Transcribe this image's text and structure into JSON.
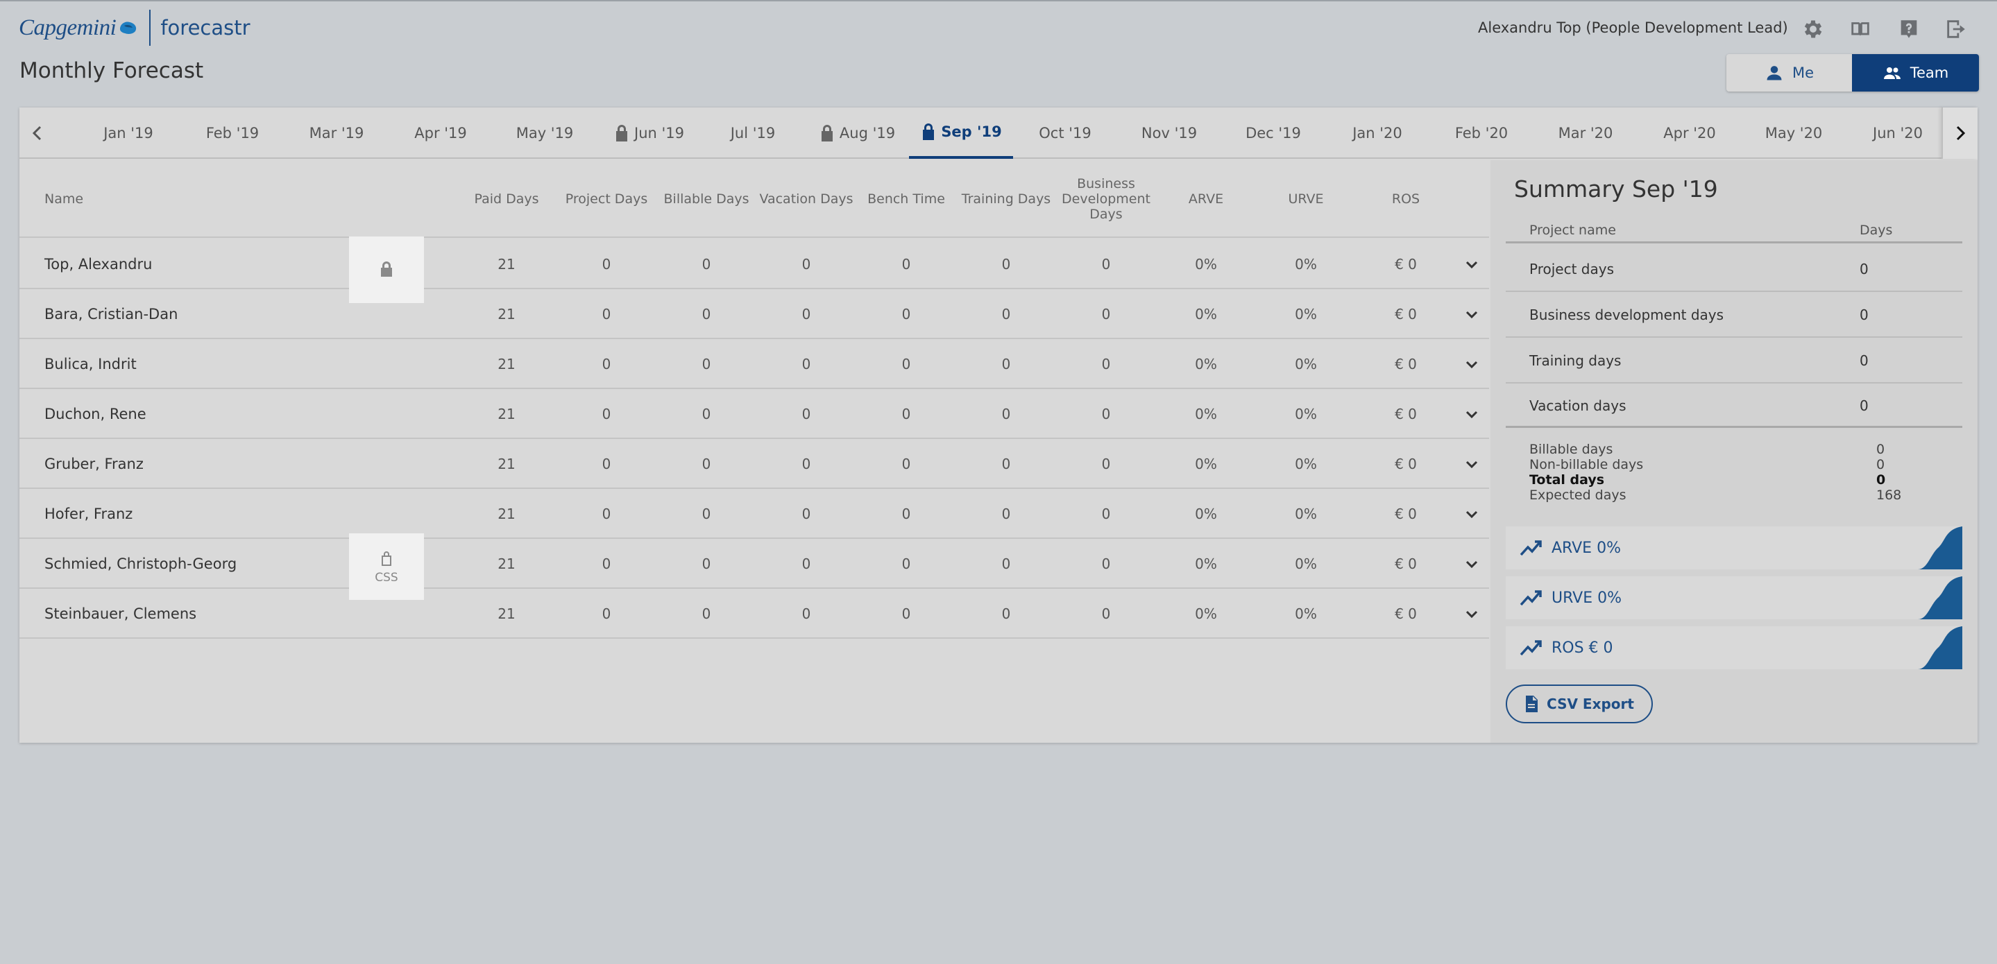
{
  "header": {
    "logo_brand": "Capgemini",
    "logo_product": "forecastr",
    "user": "Alexandru Top (People Development Lead)",
    "icons": [
      "gear-icon",
      "book-icon",
      "help-icon",
      "logout-icon"
    ]
  },
  "page_title": "Monthly Forecast",
  "view_toggle": {
    "me": "Me",
    "team": "Team",
    "selected": "Team"
  },
  "months": [
    {
      "label": "Jan '19",
      "locked": false
    },
    {
      "label": "Feb '19",
      "locked": false
    },
    {
      "label": "Mar '19",
      "locked": false
    },
    {
      "label": "Apr '19",
      "locked": false
    },
    {
      "label": "May '19",
      "locked": false
    },
    {
      "label": "Jun '19",
      "locked": true
    },
    {
      "label": "Jul '19",
      "locked": false
    },
    {
      "label": "Aug '19",
      "locked": true
    },
    {
      "label": "Sep '19",
      "locked": true,
      "active": true
    },
    {
      "label": "Oct '19",
      "locked": false
    },
    {
      "label": "Nov '19",
      "locked": false
    },
    {
      "label": "Dec '19",
      "locked": false
    },
    {
      "label": "Jan '20",
      "locked": false
    },
    {
      "label": "Feb '20",
      "locked": false
    },
    {
      "label": "Mar '20",
      "locked": false
    },
    {
      "label": "Apr '20",
      "locked": false
    },
    {
      "label": "May '20",
      "locked": false
    },
    {
      "label": "Jun '20",
      "locked": false
    }
  ],
  "table": {
    "columns": {
      "name": "Name",
      "paid": "Paid Days",
      "project": "Project Days",
      "billable": "Billable Days",
      "vacation": "Vacation Days",
      "bench": "Bench Time",
      "training": "Training Days",
      "bizdev": "Business Development Days",
      "arve": "ARVE",
      "urve": "URVE",
      "ros": "ROS"
    },
    "rows": [
      {
        "name": "Top, Alexandru",
        "paid": "21",
        "project": "0",
        "billable": "0",
        "vacation": "0",
        "bench": "0",
        "training": "0",
        "bizdev": "0",
        "arve": "0%",
        "urve": "0%",
        "ros": "€ 0"
      },
      {
        "name": "Bara, Cristian-Dan",
        "paid": "21",
        "project": "0",
        "billable": "0",
        "vacation": "0",
        "bench": "0",
        "training": "0",
        "bizdev": "0",
        "arve": "0%",
        "urve": "0%",
        "ros": "€ 0"
      },
      {
        "name": "Bulica, Indrit",
        "paid": "21",
        "project": "0",
        "billable": "0",
        "vacation": "0",
        "bench": "0",
        "training": "0",
        "bizdev": "0",
        "arve": "0%",
        "urve": "0%",
        "ros": "€ 0"
      },
      {
        "name": "Duchon, Rene",
        "paid": "21",
        "project": "0",
        "billable": "0",
        "vacation": "0",
        "bench": "0",
        "training": "0",
        "bizdev": "0",
        "arve": "0%",
        "urve": "0%",
        "ros": "€ 0"
      },
      {
        "name": "Gruber, Franz",
        "paid": "21",
        "project": "0",
        "billable": "0",
        "vacation": "0",
        "bench": "0",
        "training": "0",
        "bizdev": "0",
        "arve": "0%",
        "urve": "0%",
        "ros": "€ 0"
      },
      {
        "name": "Hofer, Franz",
        "paid": "21",
        "project": "0",
        "billable": "0",
        "vacation": "0",
        "bench": "0",
        "training": "0",
        "bizdev": "0",
        "arve": "0%",
        "urve": "0%",
        "ros": "€ 0"
      },
      {
        "name": "Schmied, Christoph-Georg",
        "paid": "21",
        "project": "0",
        "billable": "0",
        "vacation": "0",
        "bench": "0",
        "training": "0",
        "bizdev": "0",
        "arve": "0%",
        "urve": "0%",
        "ros": "€ 0"
      },
      {
        "name": "Steinbauer, Clemens",
        "paid": "21",
        "project": "0",
        "billable": "0",
        "vacation": "0",
        "bench": "0",
        "training": "0",
        "bizdev": "0",
        "arve": "0%",
        "urve": "0%",
        "ros": "€ 0"
      }
    ],
    "lock_cells": {
      "locked": "",
      "unlocked": "CSS"
    }
  },
  "summary": {
    "title": "Summary Sep '19",
    "col_project": "Project name",
    "col_days": "Days",
    "rows": [
      {
        "label": "Project days",
        "value": "0"
      },
      {
        "label": "Business development days",
        "value": "0"
      },
      {
        "label": "Training days",
        "value": "0"
      },
      {
        "label": "Vacation days",
        "value": "0"
      }
    ],
    "totals": {
      "billable_label": "Billable days",
      "billable": "0",
      "nonbillable_label": "Non-billable days",
      "nonbillable": "0",
      "total_label": "Total days",
      "total": "0",
      "expected_label": "Expected days",
      "expected": "168"
    },
    "metrics": {
      "arve": "ARVE 0%",
      "urve": "URVE 0%",
      "ros": "ROS € 0"
    },
    "csv_label": "CSV Export"
  },
  "colors": {
    "brand": "#1e4e86",
    "accent": "#0f3e7a",
    "background": "#c9cdd1"
  }
}
